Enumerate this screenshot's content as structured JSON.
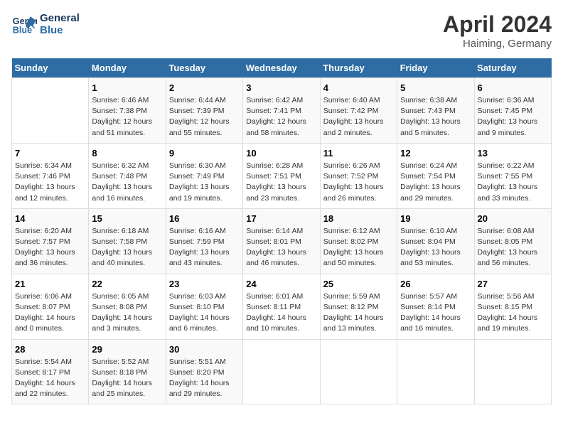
{
  "logo": {
    "line1": "General",
    "line2": "Blue"
  },
  "title": "April 2024",
  "location": "Haiming, Germany",
  "days_header": [
    "Sunday",
    "Monday",
    "Tuesday",
    "Wednesday",
    "Thursday",
    "Friday",
    "Saturday"
  ],
  "weeks": [
    [
      {
        "day": "",
        "info": ""
      },
      {
        "day": "1",
        "info": "Sunrise: 6:46 AM\nSunset: 7:38 PM\nDaylight: 12 hours\nand 51 minutes."
      },
      {
        "day": "2",
        "info": "Sunrise: 6:44 AM\nSunset: 7:39 PM\nDaylight: 12 hours\nand 55 minutes."
      },
      {
        "day": "3",
        "info": "Sunrise: 6:42 AM\nSunset: 7:41 PM\nDaylight: 12 hours\nand 58 minutes."
      },
      {
        "day": "4",
        "info": "Sunrise: 6:40 AM\nSunset: 7:42 PM\nDaylight: 13 hours\nand 2 minutes."
      },
      {
        "day": "5",
        "info": "Sunrise: 6:38 AM\nSunset: 7:43 PM\nDaylight: 13 hours\nand 5 minutes."
      },
      {
        "day": "6",
        "info": "Sunrise: 6:36 AM\nSunset: 7:45 PM\nDaylight: 13 hours\nand 9 minutes."
      }
    ],
    [
      {
        "day": "7",
        "info": "Sunrise: 6:34 AM\nSunset: 7:46 PM\nDaylight: 13 hours\nand 12 minutes."
      },
      {
        "day": "8",
        "info": "Sunrise: 6:32 AM\nSunset: 7:48 PM\nDaylight: 13 hours\nand 16 minutes."
      },
      {
        "day": "9",
        "info": "Sunrise: 6:30 AM\nSunset: 7:49 PM\nDaylight: 13 hours\nand 19 minutes."
      },
      {
        "day": "10",
        "info": "Sunrise: 6:28 AM\nSunset: 7:51 PM\nDaylight: 13 hours\nand 23 minutes."
      },
      {
        "day": "11",
        "info": "Sunrise: 6:26 AM\nSunset: 7:52 PM\nDaylight: 13 hours\nand 26 minutes."
      },
      {
        "day": "12",
        "info": "Sunrise: 6:24 AM\nSunset: 7:54 PM\nDaylight: 13 hours\nand 29 minutes."
      },
      {
        "day": "13",
        "info": "Sunrise: 6:22 AM\nSunset: 7:55 PM\nDaylight: 13 hours\nand 33 minutes."
      }
    ],
    [
      {
        "day": "14",
        "info": "Sunrise: 6:20 AM\nSunset: 7:57 PM\nDaylight: 13 hours\nand 36 minutes."
      },
      {
        "day": "15",
        "info": "Sunrise: 6:18 AM\nSunset: 7:58 PM\nDaylight: 13 hours\nand 40 minutes."
      },
      {
        "day": "16",
        "info": "Sunrise: 6:16 AM\nSunset: 7:59 PM\nDaylight: 13 hours\nand 43 minutes."
      },
      {
        "day": "17",
        "info": "Sunrise: 6:14 AM\nSunset: 8:01 PM\nDaylight: 13 hours\nand 46 minutes."
      },
      {
        "day": "18",
        "info": "Sunrise: 6:12 AM\nSunset: 8:02 PM\nDaylight: 13 hours\nand 50 minutes."
      },
      {
        "day": "19",
        "info": "Sunrise: 6:10 AM\nSunset: 8:04 PM\nDaylight: 13 hours\nand 53 minutes."
      },
      {
        "day": "20",
        "info": "Sunrise: 6:08 AM\nSunset: 8:05 PM\nDaylight: 13 hours\nand 56 minutes."
      }
    ],
    [
      {
        "day": "21",
        "info": "Sunrise: 6:06 AM\nSunset: 8:07 PM\nDaylight: 14 hours\nand 0 minutes."
      },
      {
        "day": "22",
        "info": "Sunrise: 6:05 AM\nSunset: 8:08 PM\nDaylight: 14 hours\nand 3 minutes."
      },
      {
        "day": "23",
        "info": "Sunrise: 6:03 AM\nSunset: 8:10 PM\nDaylight: 14 hours\nand 6 minutes."
      },
      {
        "day": "24",
        "info": "Sunrise: 6:01 AM\nSunset: 8:11 PM\nDaylight: 14 hours\nand 10 minutes."
      },
      {
        "day": "25",
        "info": "Sunrise: 5:59 AM\nSunset: 8:12 PM\nDaylight: 14 hours\nand 13 minutes."
      },
      {
        "day": "26",
        "info": "Sunrise: 5:57 AM\nSunset: 8:14 PM\nDaylight: 14 hours\nand 16 minutes."
      },
      {
        "day": "27",
        "info": "Sunrise: 5:56 AM\nSunset: 8:15 PM\nDaylight: 14 hours\nand 19 minutes."
      }
    ],
    [
      {
        "day": "28",
        "info": "Sunrise: 5:54 AM\nSunset: 8:17 PM\nDaylight: 14 hours\nand 22 minutes."
      },
      {
        "day": "29",
        "info": "Sunrise: 5:52 AM\nSunset: 8:18 PM\nDaylight: 14 hours\nand 25 minutes."
      },
      {
        "day": "30",
        "info": "Sunrise: 5:51 AM\nSunset: 8:20 PM\nDaylight: 14 hours\nand 29 minutes."
      },
      {
        "day": "",
        "info": ""
      },
      {
        "day": "",
        "info": ""
      },
      {
        "day": "",
        "info": ""
      },
      {
        "day": "",
        "info": ""
      }
    ]
  ]
}
